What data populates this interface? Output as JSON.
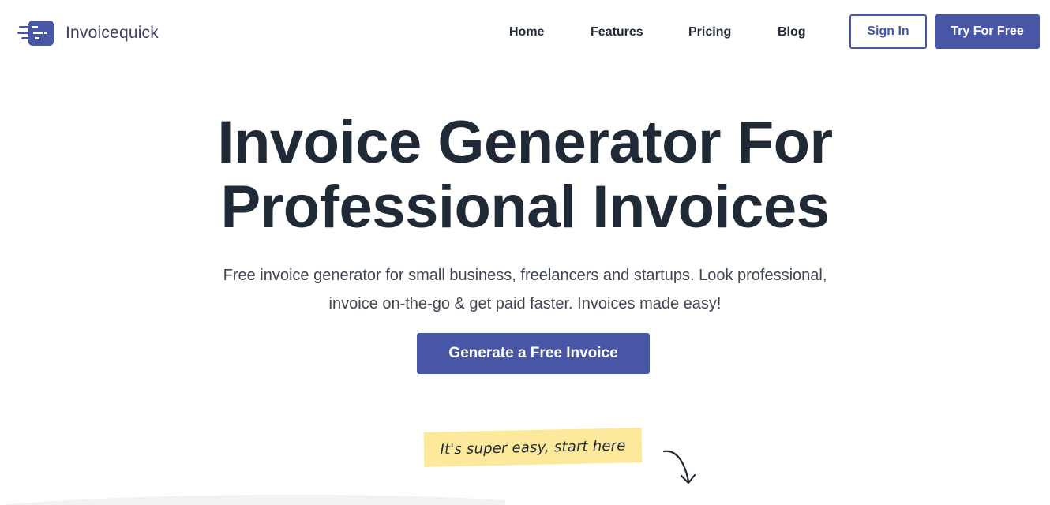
{
  "header": {
    "brand": "Invoicequick",
    "logo_icon": "invoice-logo-icon",
    "nav": [
      {
        "label": "Home"
      },
      {
        "label": "Features"
      },
      {
        "label": "Pricing"
      },
      {
        "label": "Blog"
      }
    ],
    "sign_in_label": "Sign In",
    "try_free_label": "Try For Free"
  },
  "hero": {
    "title_line1": "Invoice Generator For",
    "title_line2": "Professional Invoices",
    "subtitle_line1": "Free invoice generator for small business, freelancers and startups. Look professional,",
    "subtitle_line2": "invoice on-the-go & get paid faster. Invoices made easy!",
    "cta_label": "Generate a Free Invoice",
    "note": "It's super easy, start here",
    "arrow_icon": "curved-arrow-down-icon"
  },
  "colors": {
    "brand": "#4856a6",
    "text": "#1f2a36",
    "note_bg": "#fce99b",
    "logo_text": "#3d3f63"
  }
}
